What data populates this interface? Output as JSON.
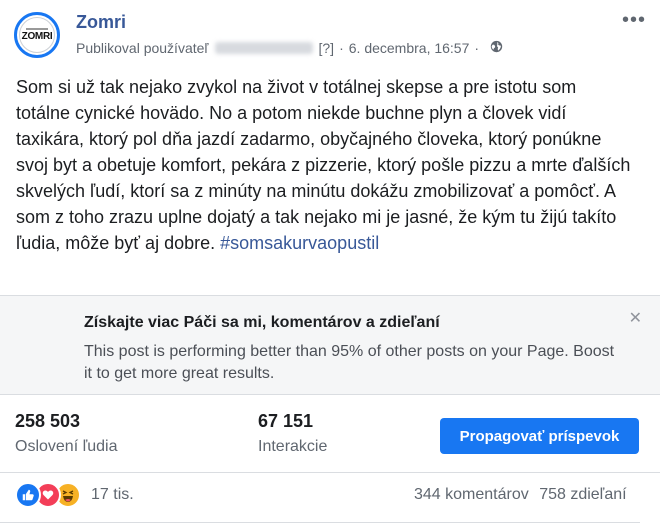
{
  "post": {
    "page_name": "Zomri",
    "avatar_text": "ZOMRI",
    "meta_prefix": "Publikoval používateľ",
    "meta_help": "[?]",
    "meta_separator": "·",
    "date": "6. decembra, 16:57",
    "text": "Som si už tak nejako zvykol na život v totálnej skepse a pre istotu som totálne cynické hovädo. No a potom niekde buchne plyn a človek vidí taxikára, ktorý pol dňa jazdí zadarmo, obyčajného človeka, ktorý ponúkne svoj byt a obetuje komfort, pekára z pizzerie, ktorý pošle pizzu a mrte ďalších skvelých ľudí, ktorí sa z minúty na minútu dokážu zmobilizovať a pomôcť. A som z toho zrazu uplne dojatý a tak nejako mi je jasné, že kým tu žijú takíto ľudia, môže byť aj dobre.",
    "hashtag": "#somsakurvaopustil"
  },
  "boost_box": {
    "title": "Získajte viac Páči sa mi, komentárov a zdieľaní",
    "text": "This post is performing better than 95% of other posts on your Page. Boost it to get more great results."
  },
  "stats": {
    "reach_value": "258 503",
    "reach_label": "Oslovení ľudia",
    "engagement_value": "67 151",
    "engagement_label": "Interakcie",
    "boost_button": "Propagovať príspevok"
  },
  "reactions": {
    "icons": [
      "like-icon",
      "love-icon",
      "haha-icon"
    ],
    "count": "17 tis.",
    "comments": "344 komentárov",
    "shares": "758 zdieľaní"
  },
  "colors": {
    "accent": "#1877f2",
    "link": "#385898",
    "boost_bg": "#f5f6f7"
  }
}
